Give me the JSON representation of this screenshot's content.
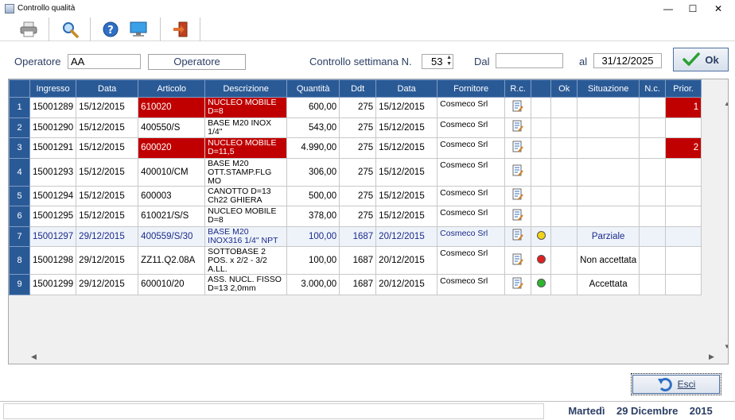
{
  "window": {
    "title": "Controllo qualità",
    "minimize": "—",
    "maximize": "☐",
    "close": "✕"
  },
  "toolbar": {
    "buttons": [
      {
        "name": "print-button",
        "icon": "printer-icon"
      },
      {
        "name": "search-button",
        "icon": "magnifier-icon"
      },
      {
        "name": "help-button",
        "icon": "help-icon"
      },
      {
        "name": "monitor-button",
        "icon": "monitor-icon"
      },
      {
        "name": "exit-toolbar-button",
        "icon": "exit-door-icon"
      }
    ]
  },
  "form": {
    "operatore_label": "Operatore",
    "operatore_value": "AA",
    "operatore_button": "Operatore",
    "controllo_label": "Controllo settimana N.",
    "settimana_value": "53",
    "dal_label": "Dal",
    "dal_value": "",
    "al_label": "al",
    "al_value": "31/12/2025",
    "ok_label": "Ok"
  },
  "grid": {
    "columns": [
      "Ingresso",
      "Data",
      "Articolo",
      "Descrizione",
      "Quantità",
      "Ddt",
      "Data",
      "Fornitore",
      "R.c.",
      "",
      "Ok",
      "Situazione",
      "N.c.",
      "Prior."
    ],
    "rows": [
      {
        "n": "1",
        "ingresso": "15001289",
        "data": "15/12/2015",
        "articolo": "610020",
        "descrizione": "NUCLEO MOBILE D=8",
        "quantita": "600,00",
        "ddt": "275",
        "data_ddt": "15/12/2015",
        "fornitore": "Cosmeco Srl",
        "status": "",
        "situazione": "",
        "prior": "1",
        "red": true,
        "selected": false
      },
      {
        "n": "2",
        "ingresso": "15001290",
        "data": "15/12/2015",
        "articolo": "400550/S",
        "descrizione": "BASE M20 INOX 1/4\"",
        "quantita": "543,00",
        "ddt": "275",
        "data_ddt": "15/12/2015",
        "fornitore": "Cosmeco Srl",
        "status": "",
        "situazione": "",
        "prior": "",
        "red": false,
        "selected": false
      },
      {
        "n": "3",
        "ingresso": "15001291",
        "data": "15/12/2015",
        "articolo": "600020",
        "descrizione": "NUCLEO MOBILE D=11,5",
        "quantita": "4.990,00",
        "ddt": "275",
        "data_ddt": "15/12/2015",
        "fornitore": "Cosmeco Srl",
        "status": "",
        "situazione": "",
        "prior": "2",
        "red": true,
        "selected": false
      },
      {
        "n": "4",
        "ingresso": "15001293",
        "data": "15/12/2015",
        "articolo": "400010/CM",
        "descrizione": "BASE M20 OTT.STAMP.FLG MO",
        "quantita": "306,00",
        "ddt": "275",
        "data_ddt": "15/12/2015",
        "fornitore": "Cosmeco Srl",
        "status": "",
        "situazione": "",
        "prior": "",
        "red": false,
        "selected": false
      },
      {
        "n": "5",
        "ingresso": "15001294",
        "data": "15/12/2015",
        "articolo": "600003",
        "descrizione": "CANOTTO D=13 Ch22 GHIERA",
        "quantita": "500,00",
        "ddt": "275",
        "data_ddt": "15/12/2015",
        "fornitore": "Cosmeco Srl",
        "status": "",
        "situazione": "",
        "prior": "",
        "red": false,
        "selected": false
      },
      {
        "n": "6",
        "ingresso": "15001295",
        "data": "15/12/2015",
        "articolo": "610021/S/S",
        "descrizione": "NUCLEO MOBILE D=8",
        "quantita": "378,00",
        "ddt": "275",
        "data_ddt": "15/12/2015",
        "fornitore": "Cosmeco Srl",
        "status": "",
        "situazione": "",
        "prior": "",
        "red": false,
        "selected": false
      },
      {
        "n": "7",
        "ingresso": "15001297",
        "data": "29/12/2015",
        "articolo": "400559/S/30",
        "descrizione": "BASE M20 INOX316 1/4\" NPT",
        "quantita": "100,00",
        "ddt": "1687",
        "data_ddt": "20/12/2015",
        "fornitore": "Cosmeco Srl",
        "status": "yellow",
        "situazione": "Parziale",
        "prior": "",
        "red": false,
        "selected": true
      },
      {
        "n": "8",
        "ingresso": "15001298",
        "data": "29/12/2015",
        "articolo": "ZZ11.Q2.08A",
        "descrizione": "SOTTOBASE 2 POS. x 2/2 - 3/2 A.LL.",
        "quantita": "100,00",
        "ddt": "1687",
        "data_ddt": "20/12/2015",
        "fornitore": "Cosmeco Srl",
        "status": "red",
        "situazione": "Non accettata",
        "prior": "",
        "red": false,
        "selected": false
      },
      {
        "n": "9",
        "ingresso": "15001299",
        "data": "29/12/2015",
        "articolo": "600010/20",
        "descrizione": "ASS. NUCL. FISSO D=13 2,0mm",
        "quantita": "3.000,00",
        "ddt": "1687",
        "data_ddt": "20/12/2015",
        "fornitore": "Cosmeco Srl",
        "status": "green",
        "situazione": "Accettata",
        "prior": "",
        "red": false,
        "selected": false
      }
    ]
  },
  "colors": {
    "header_blue": "#2a5a96",
    "priority_red": "#c00000",
    "dot_yellow": "#f2d21a",
    "dot_red": "#e02020",
    "dot_green": "#2fb52f"
  },
  "esci_label": "Esci",
  "status": {
    "date_text": "Martedì    29 Dicembre    2015"
  }
}
